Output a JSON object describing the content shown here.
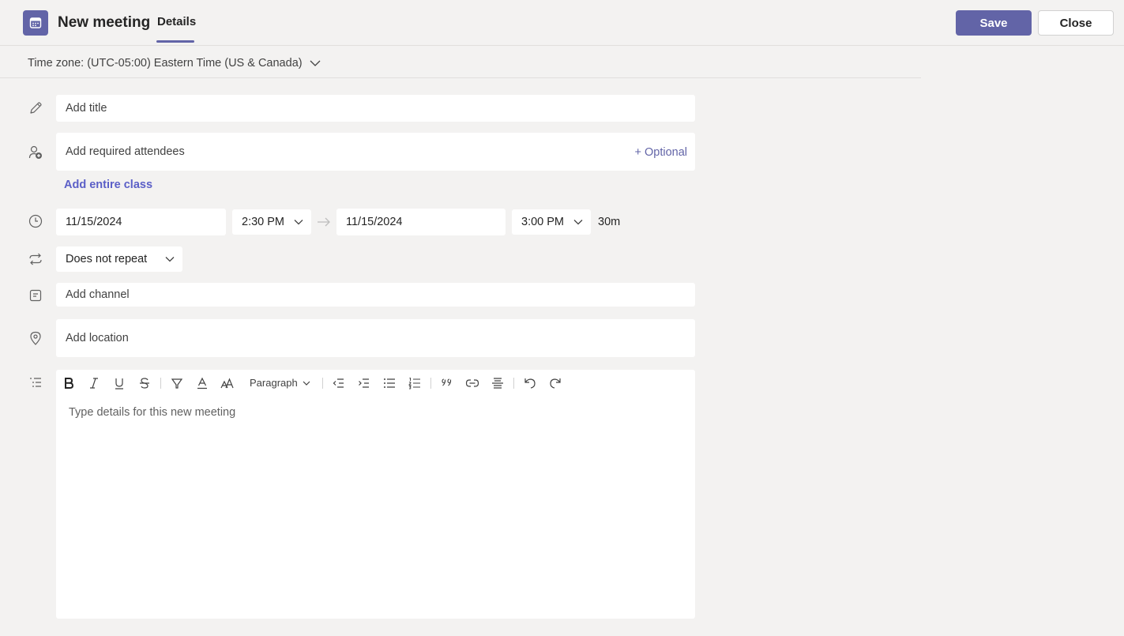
{
  "header": {
    "title": "New meeting",
    "tabs": [
      {
        "label": "Details",
        "active": true
      }
    ],
    "save_label": "Save",
    "close_label": "Close"
  },
  "timezone": {
    "text": "Time zone: (UTC-05:00) Eastern Time (US & Canada)"
  },
  "form": {
    "title_placeholder": "Add title",
    "attendees_placeholder": "Add required attendees",
    "optional_label": "+ Optional",
    "add_class_label": "Add entire class",
    "start_date": "11/15/2024",
    "start_time": "2:30 PM",
    "end_date": "11/15/2024",
    "end_time": "3:00 PM",
    "duration": "30m",
    "repeat": "Does not repeat",
    "channel_placeholder": "Add channel",
    "location_placeholder": "Add location"
  },
  "editor": {
    "format_label": "Paragraph",
    "placeholder": "Type details for this new meeting",
    "toolbar_icons": [
      "bold-icon",
      "italic-icon",
      "underline-icon",
      "strikethrough-icon",
      "highlight-icon",
      "font-color-icon",
      "font-size-icon",
      "decrease-indent-icon",
      "increase-indent-icon",
      "bullet-list-icon",
      "numbered-list-icon",
      "quote-icon",
      "link-icon",
      "horizontal-rule-icon",
      "undo-icon",
      "redo-icon"
    ]
  },
  "colors": {
    "accent": "#6264a7",
    "link": "#5b5fc7",
    "background": "#f3f2f1"
  }
}
